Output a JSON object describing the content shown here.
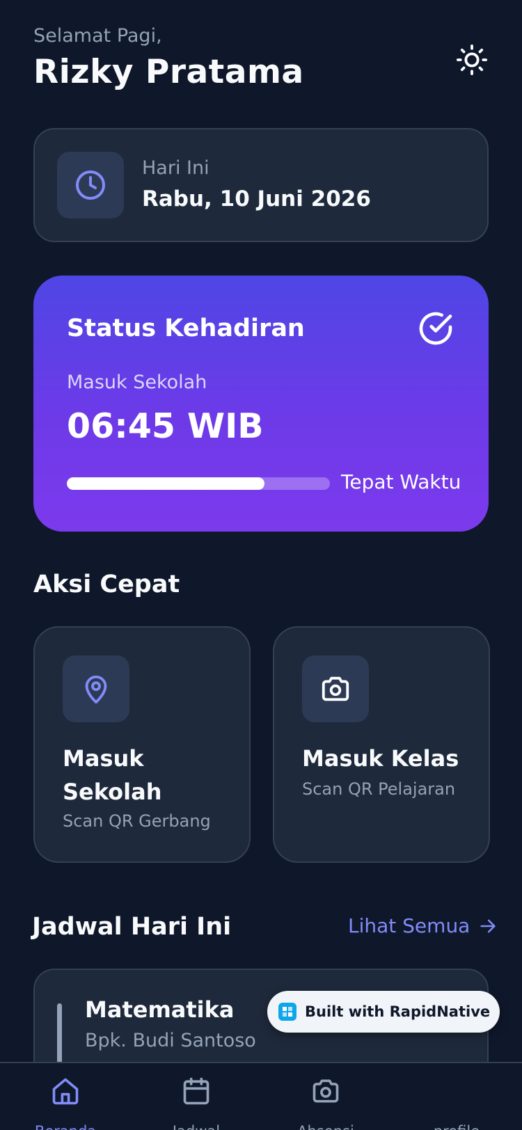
{
  "header": {
    "greeting": "Selamat Pagi,",
    "name": "Rizky Pratama",
    "theme_icon": "sun-icon"
  },
  "today": {
    "label": "Hari Ini",
    "date": "Rabu, 10 Juni 2026",
    "icon": "clock-icon"
  },
  "attendance": {
    "title": "Status Kehadiran",
    "check_icon": "check-circle-icon",
    "subtitle": "Masuk Sekolah",
    "time": "06:45 WIB",
    "progress_fraction": 0.75,
    "status": "Tepat Waktu"
  },
  "quick_actions": {
    "title": "Aksi Cepat",
    "items": [
      {
        "title": "Masuk Sekolah",
        "subtitle": "Scan QR Gerbang",
        "icon": "map-pin-icon"
      },
      {
        "title": "Masuk Kelas",
        "subtitle": "Scan QR Pelajaran",
        "icon": "camera-icon"
      }
    ]
  },
  "schedule": {
    "title": "Jadwal Hari Ini",
    "see_all": "Lihat Semua",
    "items": [
      {
        "subject": "Matematika",
        "teacher": "Bpk. Budi Santoso"
      }
    ]
  },
  "badge": {
    "text": "Built with RapidNative"
  },
  "nav": {
    "items": [
      {
        "label": "Beranda",
        "icon": "home-icon",
        "active": true
      },
      {
        "label": "Jadwal",
        "icon": "calendar-icon",
        "active": false
      },
      {
        "label": "Absensi",
        "icon": "camera-icon",
        "active": false
      },
      {
        "label": "profile",
        "icon": "user-icon",
        "active": false
      }
    ]
  },
  "colors": {
    "background": "#0f172a",
    "card": "#1e293b",
    "accent": "#818cf8",
    "gradient_start": "#4f46e5",
    "gradient_end": "#7c3aed"
  }
}
